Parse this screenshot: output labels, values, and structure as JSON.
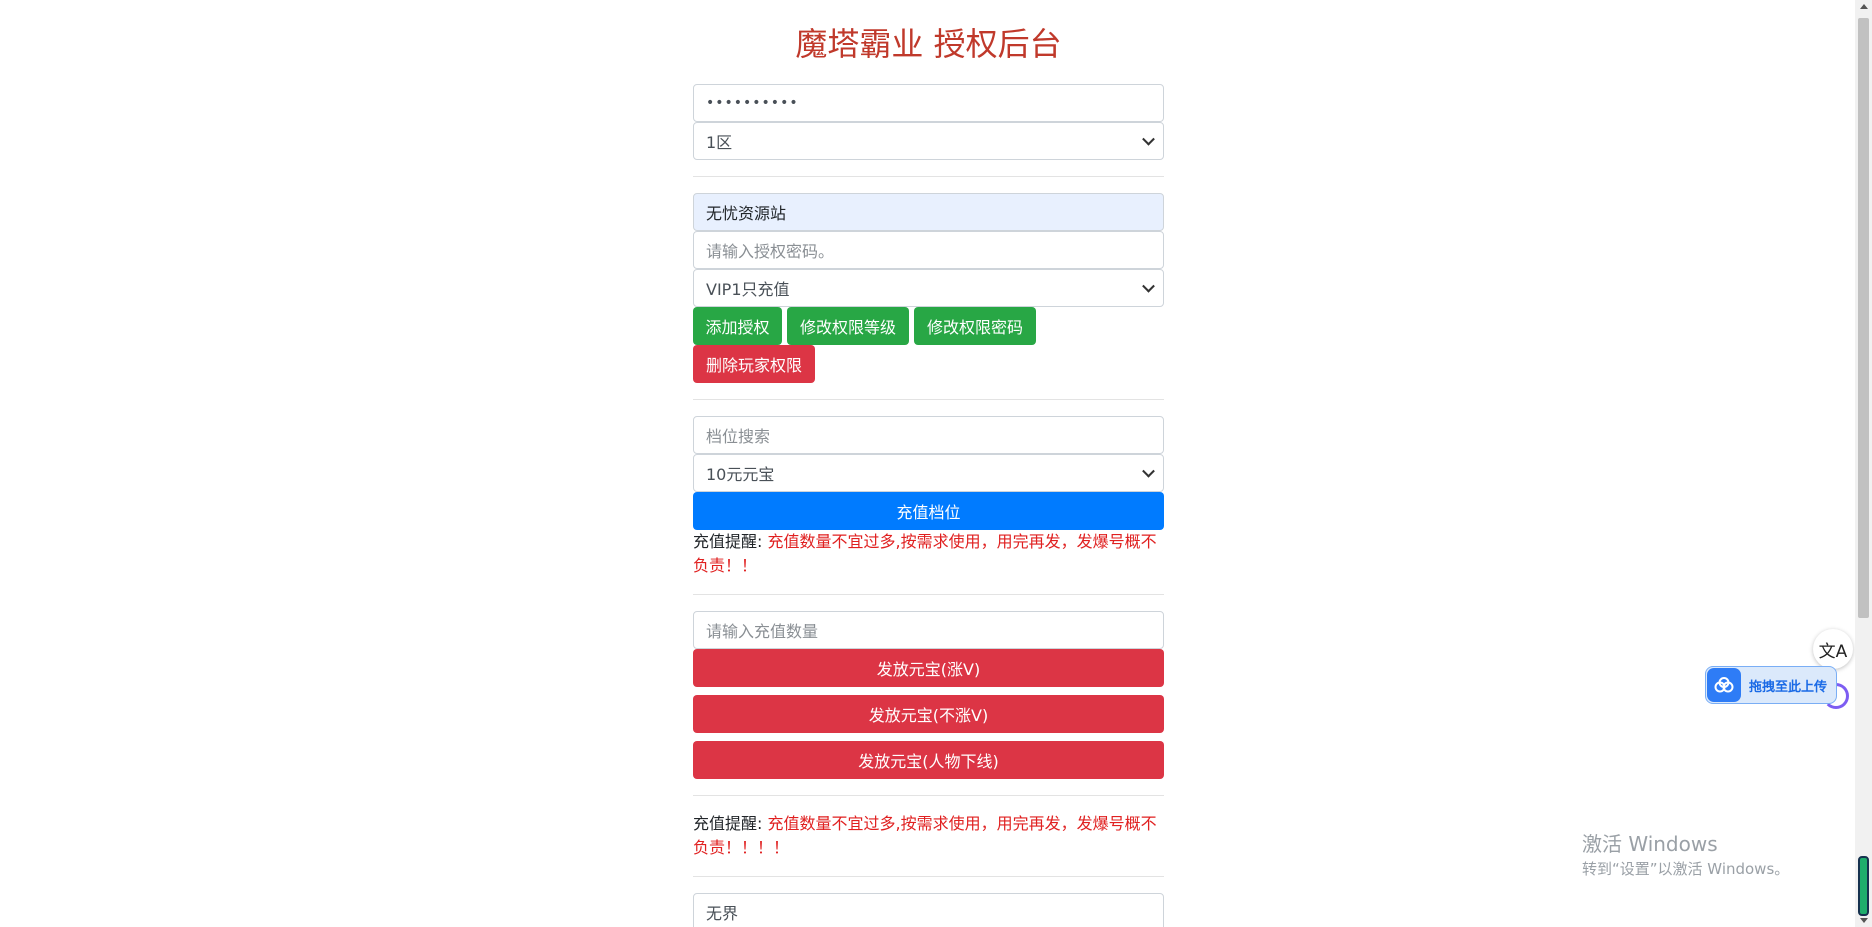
{
  "title": "魔塔霸业 授权后台",
  "login": {
    "password_value": "••••••••••",
    "server_select": "1区"
  },
  "auth": {
    "site_name": "无忧资源站",
    "password_placeholder": "请输入授权密码。",
    "level_select": "VIP1只充值",
    "buttons": {
      "add": "添加授权",
      "modify_level": "修改权限等级",
      "modify_password": "修改权限密码",
      "delete": "删除玩家权限"
    }
  },
  "recharge": {
    "search_placeholder": "档位搜索",
    "tier_select": "10元元宝",
    "submit": "充值档位",
    "reminder_label": "充值提醒:",
    "reminder_text": "充值数量不宜过多,按需求使用，用完再发，发爆号概不负责！！"
  },
  "ingot": {
    "amount_placeholder": "请输入充值数量",
    "buttons": {
      "with_v": "发放元宝(涨V)",
      "without_v": "发放元宝(不涨V)",
      "offline": "发放元宝(人物下线)"
    },
    "reminder_label": "充值提醒:",
    "reminder_text": "充值数量不宜过多,按需求使用，用完再发，发爆号概不负责！！！！"
  },
  "bottom_field": "无界",
  "widgets": {
    "upload_label": "拖拽至此上传",
    "translate_glyph": "文A"
  },
  "watermark": {
    "line1": "激活 Windows",
    "line2": "转到“设置”以激活 Windows。"
  },
  "colors": {
    "title": "#c0392b",
    "green": "#28a745",
    "red": "#dc3545",
    "blue": "#007bff",
    "warning_text": "#e02020"
  }
}
